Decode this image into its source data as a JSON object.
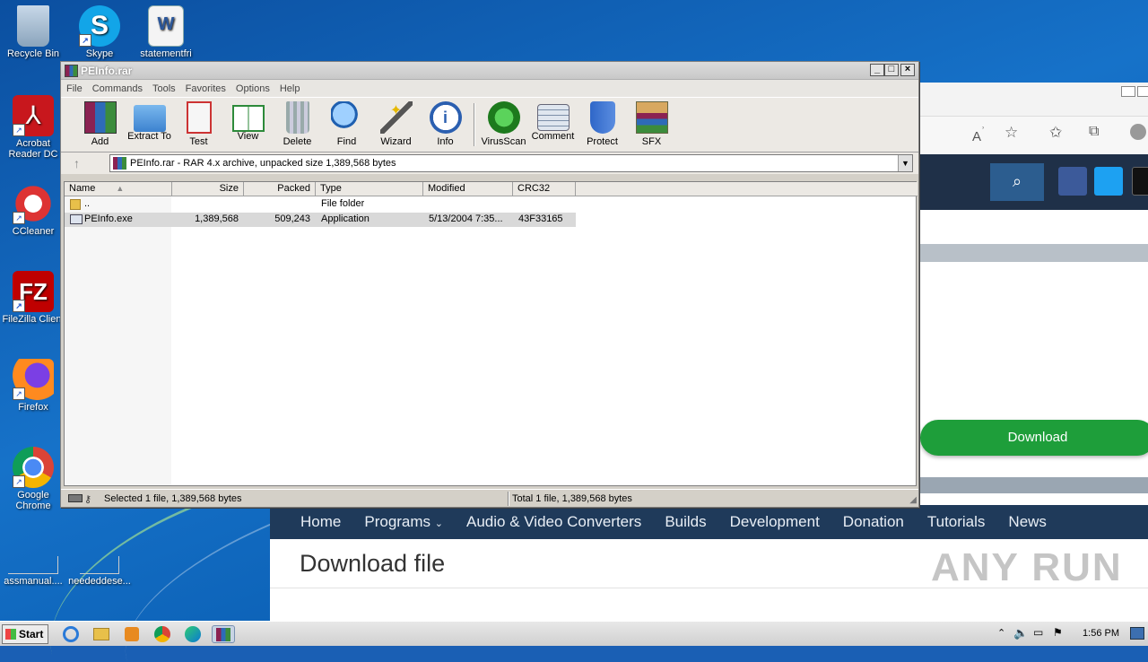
{
  "desktop": {
    "icons": [
      {
        "label": "Recycle Bin"
      },
      {
        "label": "Skype"
      },
      {
        "label": "statementfri"
      },
      {
        "label": "Acrobat Reader DC"
      },
      {
        "label": "CCleaner"
      },
      {
        "label": "FileZilla Client"
      },
      {
        "label": "Firefox"
      },
      {
        "label": "Google Chrome"
      },
      {
        "label": "assmanual...."
      },
      {
        "label": "neededdese..."
      }
    ]
  },
  "winrar": {
    "title": "PEInfo.rar",
    "menu": [
      "File",
      "Commands",
      "Tools",
      "Favorites",
      "Options",
      "Help"
    ],
    "toolbar": [
      "Add",
      "Extract To",
      "Test",
      "View",
      "Delete",
      "Find",
      "Wizard",
      "Info",
      "VirusScan",
      "Comment",
      "Protect",
      "SFX"
    ],
    "path": "PEInfo.rar - RAR 4.x archive, unpacked size 1,389,568 bytes",
    "columns": [
      "Name",
      "Size",
      "Packed",
      "Type",
      "Modified",
      "CRC32"
    ],
    "rows": [
      {
        "name": "..",
        "size": "",
        "packed": "",
        "type": "File folder",
        "modified": "",
        "crc": ""
      },
      {
        "name": "PEInfo.exe",
        "size": "1,389,568",
        "packed": "509,243",
        "type": "Application",
        "modified": "5/13/2004 7:35...",
        "crc": "43F33165"
      }
    ],
    "status_left": "Selected 1 file, 1,389,568 bytes",
    "status_right": "Total 1 file, 1,389,568 bytes"
  },
  "website": {
    "download_button": "Download",
    "nav": [
      "Home",
      "Programs",
      "Audio & Video Converters",
      "Builds",
      "Development",
      "Donation",
      "Tutorials",
      "News"
    ],
    "heading": "Download file",
    "watermark": "ANY RUN"
  },
  "taskbar": {
    "start": "Start",
    "clock": "1:56 PM"
  }
}
